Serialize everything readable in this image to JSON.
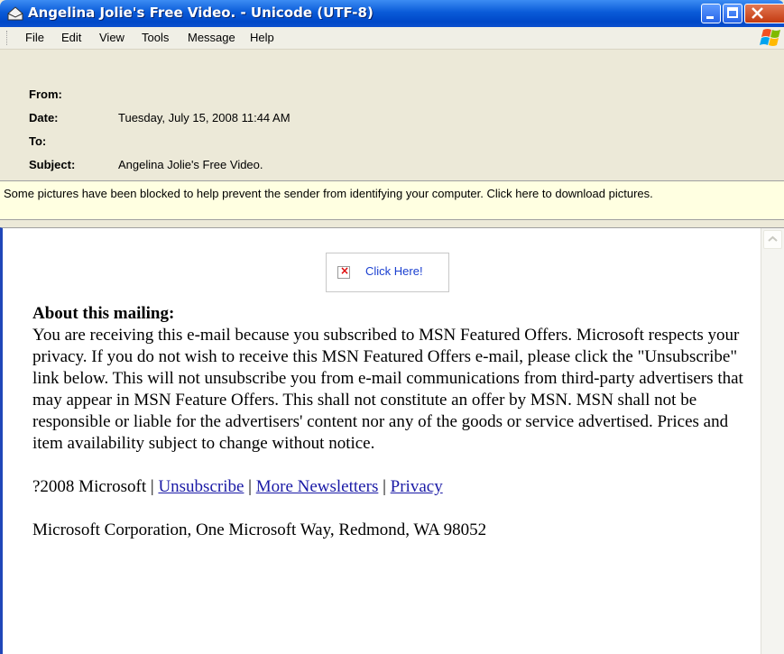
{
  "window": {
    "title": "Angelina Jolie's Free Video. - Unicode (UTF-8)",
    "buttons": [
      "minimize",
      "maximize",
      "close"
    ]
  },
  "menubar": {
    "items": [
      "File",
      "Edit",
      "View",
      "Tools",
      "Message",
      "Help"
    ]
  },
  "headers": {
    "from_label": "From:",
    "from_value": "",
    "date_label": "Date:",
    "date_value": "Tuesday, July 15, 2008 11:44 AM",
    "to_label": "To:",
    "to_value": "",
    "subject_label": "Subject:",
    "subject_value": "Angelina Jolie's Free Video."
  },
  "infobar": {
    "text": "Some pictures have been blocked to help prevent the sender from identifying your computer. Click here to download pictures."
  },
  "message": {
    "image_alt": "Click Here!",
    "heading": "About this mailing:",
    "body": "You are receiving this e-mail because you subscribed to MSN Featured Offers. Microsoft respects your privacy. If you do not wish to receive this MSN Featured Offers e-mail, please click the \"Unsubscribe\" link below. This will not unsubscribe you from e-mail communications from third-party advertisers that may appear in MSN Feature Offers. This shall not constitute an offer by MSN. MSN shall not be responsible or liable for the advertisers' content nor any of the goods or service advertised. Prices and item availability subject to change without notice.",
    "copyright": "?2008 Microsoft",
    "separator": "|",
    "links": {
      "unsubscribe": "Unsubscribe",
      "newsletters": "More Newsletters",
      "privacy": "Privacy"
    },
    "address": "Microsoft Corporation, One Microsoft Way, Redmond, WA 98052"
  },
  "colors": {
    "titlebar": "#0a5bd8",
    "chrome": "#ece9d8",
    "infobar": "#ffffe1",
    "link": "#1a1aa6"
  }
}
